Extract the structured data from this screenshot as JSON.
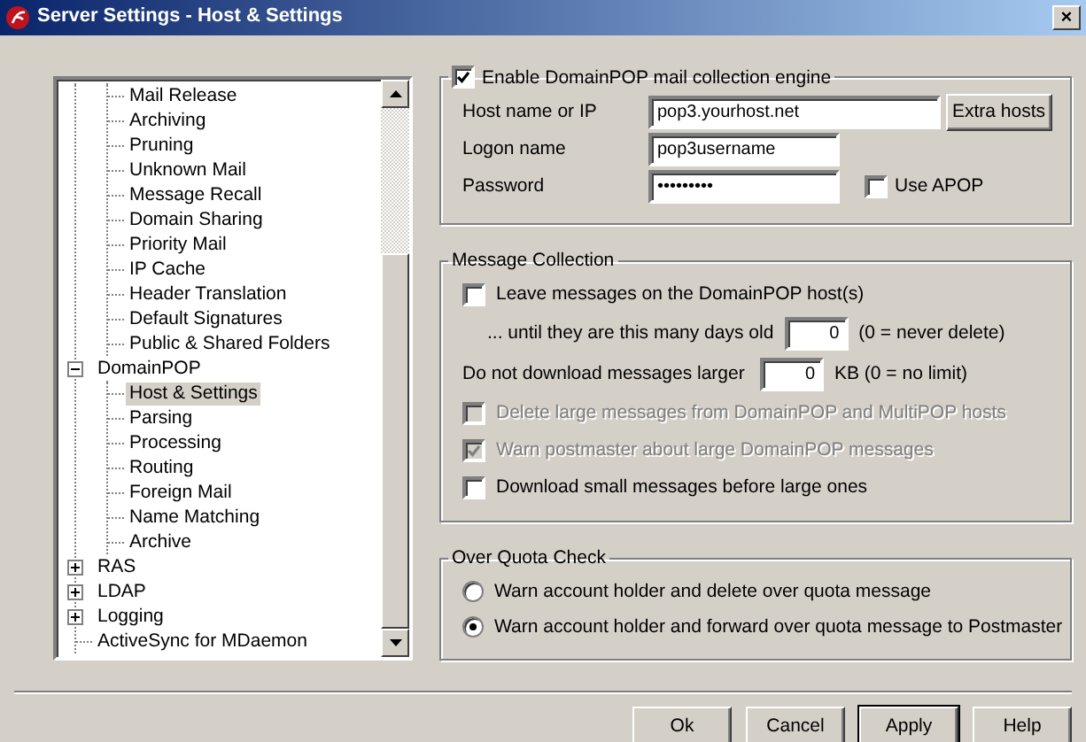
{
  "window": {
    "title": "Server Settings - Host & Settings",
    "close": "×"
  },
  "tree": [
    {
      "children": [
        {
          "label": "Mail Release",
          "selected": false
        },
        {
          "label": "Archiving",
          "selected": false
        },
        {
          "label": "Pruning",
          "selected": false
        },
        {
          "label": "Unknown Mail",
          "selected": false
        },
        {
          "label": "Message Recall",
          "selected": false
        },
        {
          "label": "Domain Sharing",
          "selected": false
        },
        {
          "label": "Priority Mail",
          "selected": false
        },
        {
          "label": "IP Cache",
          "selected": false
        },
        {
          "label": "Header Translation",
          "selected": false
        },
        {
          "label": "Default Signatures",
          "selected": false
        },
        {
          "label": "Public & Shared Folders",
          "selected": false
        }
      ]
    },
    {
      "label": "DomainPOP",
      "selected": false,
      "expanded": true,
      "children": [
        {
          "label": "Host & Settings",
          "selected": true
        },
        {
          "label": "Parsing",
          "selected": false
        },
        {
          "label": "Processing",
          "selected": false
        },
        {
          "label": "Routing",
          "selected": false
        },
        {
          "label": "Foreign Mail",
          "selected": false
        },
        {
          "label": "Name Matching",
          "selected": false
        },
        {
          "label": "Archive",
          "selected": false
        }
      ]
    },
    {
      "label": "RAS",
      "selected": false,
      "expanded": false
    },
    {
      "label": "LDAP",
      "selected": false,
      "expanded": false
    },
    {
      "label": "Logging",
      "selected": false,
      "expanded": false
    },
    {
      "label": "ActiveSync for MDaemon",
      "selected": false
    }
  ],
  "engine": {
    "label": "Enable DomainPOP mail collection engine",
    "checked": true,
    "host": {
      "label": "Host name or IP",
      "value": "pop3.yourhost.net",
      "button": "Extra hosts"
    },
    "logon": {
      "label": "Logon name",
      "value": "pop3username"
    },
    "password": {
      "label": "Password",
      "value": "•••••••••"
    },
    "apop": {
      "label": "Use APOP",
      "checked": false
    }
  },
  "message_collection": {
    "title": "Message Collection",
    "items": [
      {
        "kind": "checkbox",
        "label": "Leave messages on the DomainPOP host(s)",
        "checked": false,
        "disabled": false
      },
      {
        "kind": "subnumber",
        "label": "... until they are this many days old",
        "value": "0",
        "note": "(0 = never delete)"
      },
      {
        "kind": "number",
        "label": "Do not download messages larger",
        "value": "0",
        "note": "KB (0 = no limit)"
      },
      {
        "kind": "checkbox",
        "label": "Delete large messages from DomainPOP and MultiPOP hosts",
        "checked": false,
        "disabled": true
      },
      {
        "kind": "checkbox",
        "label": "Warn postmaster about large DomainPOP messages",
        "checked": true,
        "disabled": true
      },
      {
        "kind": "checkbox",
        "label": "Download small messages before large ones",
        "checked": false,
        "disabled": false
      }
    ]
  },
  "over_quota": {
    "title": "Over Quota Check",
    "options": [
      {
        "label": "Warn account holder and delete over quota message",
        "selected": false
      },
      {
        "label": "Warn account holder and forward over quota message to Postmaster",
        "selected": true
      }
    ]
  },
  "buttons": [
    {
      "label": "Ok",
      "default": false
    },
    {
      "label": "Cancel",
      "default": false
    },
    {
      "label": "Apply",
      "default": true
    },
    {
      "label": "Help",
      "default": false
    }
  ]
}
